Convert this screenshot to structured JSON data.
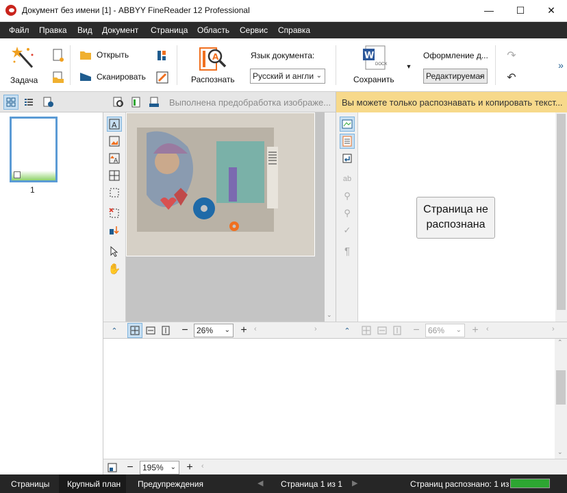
{
  "window": {
    "title": "Документ без имени [1] - ABBYY FineReader 12 Professional",
    "minimize": "—",
    "maximize": "☐",
    "close": "✕"
  },
  "menu": [
    "Файл",
    "Правка",
    "Вид",
    "Документ",
    "Страница",
    "Область",
    "Сервис",
    "Справка"
  ],
  "ribbon": {
    "task_label": "Задача",
    "open_label": "Открыть",
    "scan_label": "Сканировать",
    "recognize_label": "Распознать",
    "doc_language_label": "Язык документа:",
    "doc_language_value": "Русский и англи",
    "save_label": "Сохранить",
    "docx_badge": "DOCX",
    "format_label": "Оформление д...",
    "format_value": "Редактируемая",
    "more": "»"
  },
  "image_pane": {
    "status": "Выполнена предобработка изображе...",
    "zoom": "26%"
  },
  "text_pane": {
    "info": "Вы можете только распознавать и копировать текст...",
    "not_recognized": "Страница не распознана",
    "zoom": "66%"
  },
  "zoom_pane": {
    "zoom": "195%"
  },
  "pages": {
    "thumb_number": "1"
  },
  "statusbar": {
    "tab_pages": "Страницы",
    "tab_zoom": "Крупный план",
    "tab_warnings": "Предупреждения",
    "page_info": "Страница 1 из 1",
    "recognized": "Страниц распознано: 1 из 1",
    "progress_fraction": 1.0
  },
  "colors": {
    "menubar": "#2b2b2b",
    "info_bar": "#f7d98b",
    "accent_blue": "#5b9bd5",
    "progress_green": "#2da632",
    "brand_red": "#c9241c"
  }
}
